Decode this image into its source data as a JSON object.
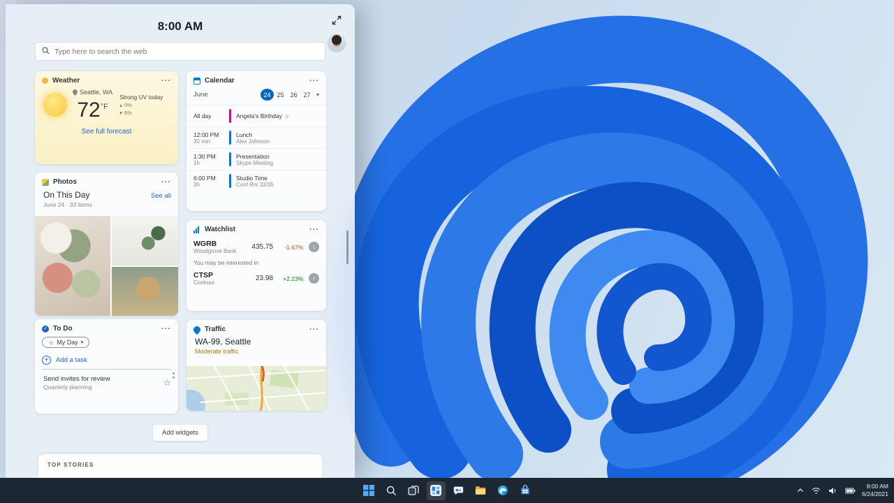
{
  "panel": {
    "time": "8:00 AM",
    "search_placeholder": "Type here to search the web",
    "add_widgets_label": "Add widgets",
    "top_stories_label": "TOP STORIES"
  },
  "weather": {
    "title": "Weather",
    "location": "Seattle, WA",
    "temperature": "72",
    "unit": "°F",
    "condition": "Strong UV today",
    "stats": [
      "0%",
      "6%"
    ],
    "link": "See full forecast"
  },
  "calendar": {
    "title": "Calendar",
    "month": "June",
    "days": [
      "24",
      "25",
      "26",
      "27"
    ],
    "selected_day": "24",
    "events": [
      {
        "time": "All day",
        "duration": "",
        "title": "Angela's Birthday",
        "subtitle": "",
        "color": "#e3008c"
      },
      {
        "time": "12:00 PM",
        "duration": "30 min",
        "title": "Lunch",
        "subtitle": "Alex Johnson",
        "color": "#0078d4"
      },
      {
        "time": "1:30 PM",
        "duration": "1h",
        "title": "Presentation",
        "subtitle": "Skype Meeting",
        "color": "#0078d4"
      },
      {
        "time": "6:00 PM",
        "duration": "3h",
        "title": "Studio Time",
        "subtitle": "Conf Rm 32/35",
        "color": "#0078d4"
      }
    ]
  },
  "photos": {
    "title": "Photos",
    "heading": "On This Day",
    "subtitle": "June 24 · 33 items",
    "see_all": "See all"
  },
  "watchlist": {
    "title": "Watchlist",
    "interest_text": "You may be interested in",
    "stocks": [
      {
        "symbol": "WGRB",
        "name": "Woodgrove Bank",
        "price": "435.75",
        "change": "-1.67%",
        "change_color": "#c75000",
        "direction": "down",
        "arrow": "↓"
      },
      {
        "symbol": "CTSP",
        "name": "Contoso",
        "price": "23.98",
        "change": "+2.23%",
        "change_color": "#107c10",
        "direction": "up",
        "arrow": "↑"
      }
    ]
  },
  "todo": {
    "title": "To Do",
    "list_label": "My Day",
    "add_task_label": "Add a task",
    "task_title": "Send invites for review",
    "task_subtitle": "Quarterly planning"
  },
  "traffic": {
    "title": "Traffic",
    "location": "WA-99, Seattle",
    "status": "Moderate traffic"
  },
  "taskbar": {
    "icons": [
      "start",
      "search",
      "task-view",
      "widgets",
      "chat",
      "file-explorer",
      "edge",
      "store"
    ],
    "active_icon": "widgets",
    "tray_icons": [
      "chevron-up",
      "network",
      "volume",
      "battery"
    ],
    "tray_time": "8:00 AM",
    "tray_date": "6/24/2021"
  },
  "colors": {
    "accent": "#0067c0",
    "event_pink": "#e3008c",
    "event_blue": "#0078d4",
    "stock_down": "#c75000",
    "stock_up": "#107c10",
    "traffic_status": "#b97a00",
    "taskbar_bg": "#1d2733"
  }
}
